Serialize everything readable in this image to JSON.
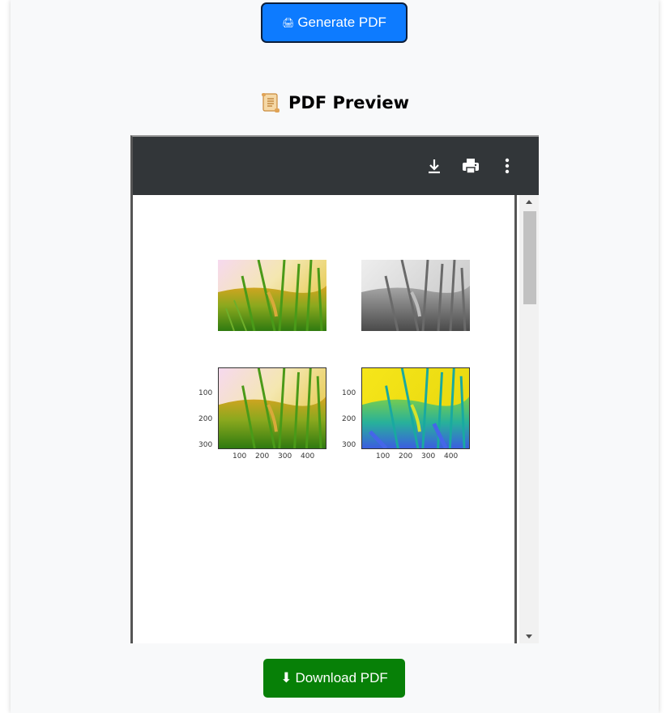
{
  "generate_button": {
    "icon": "🖨",
    "label": "Generate PDF"
  },
  "preview": {
    "icon": "scroll-icon",
    "title": "PDF Preview"
  },
  "pdf_toolbar": {
    "icons": [
      "download-icon",
      "print-icon",
      "more-vert-icon"
    ]
  },
  "pdf_page": {
    "plot_ticks": {
      "y": [
        "100",
        "200",
        "300"
      ],
      "x": [
        "100",
        "200",
        "300",
        "400"
      ]
    },
    "images": [
      "original-rice-image",
      "grayscale-rice-image",
      "original-rice-plot",
      "colormap-rice-plot"
    ]
  },
  "download_button": {
    "icon": "⬇",
    "label": "Download PDF"
  },
  "colors": {
    "primary": "#0d7bff",
    "success": "#078007",
    "toolbar": "#323639"
  }
}
